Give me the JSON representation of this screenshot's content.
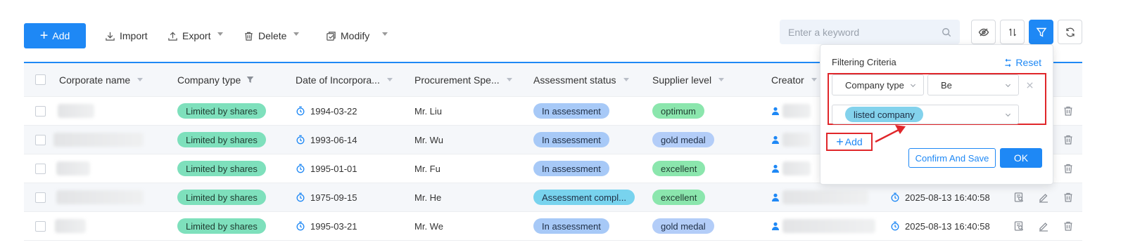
{
  "toolbar": {
    "add_label": "Add",
    "import_label": "Import",
    "export_label": "Export",
    "delete_label": "Delete",
    "modify_label": "Modify"
  },
  "search": {
    "placeholder": "Enter a keyword"
  },
  "table": {
    "columns": [
      "Corporate name",
      "Company type",
      "Date of Incorpora...",
      "Procurement Spe...",
      "Assessment status",
      "Supplier level",
      "Creator"
    ],
    "rows": [
      {
        "company_type": "Limited by shares",
        "date": "1994-03-22",
        "specialist": "Mr. Liu",
        "status": "In assessment",
        "level": "optimum",
        "created": ""
      },
      {
        "company_type": "Limited by shares",
        "date": "1993-06-14",
        "specialist": "Mr. Wu",
        "status": "In assessment",
        "level": "gold medal",
        "created": ""
      },
      {
        "company_type": "Limited by shares",
        "date": "1995-01-01",
        "specialist": "Mr. Fu",
        "status": "In assessment",
        "level": "excellent",
        "created": ""
      },
      {
        "company_type": "Limited by shares",
        "date": "1975-09-15",
        "specialist": "Mr. He",
        "status": "Assessment compl...",
        "level": "excellent",
        "created": "2025-08-13 16:40:58"
      },
      {
        "company_type": "Limited by shares",
        "date": "1995-03-21",
        "specialist": "Mr. We",
        "status": "In assessment",
        "level": "gold medal",
        "created": "2025-08-13 16:40:58"
      }
    ]
  },
  "filter": {
    "title": "Filtering Criteria",
    "reset_label": "Reset",
    "field_value": "Company type",
    "operator_value": "Be",
    "selected_value": "listed company",
    "add_label": "Add",
    "confirm_label": "Confirm And Save",
    "ok_label": "OK"
  },
  "colors": {
    "accent": "#1e88f5",
    "highlight_red": "#e0262a"
  }
}
